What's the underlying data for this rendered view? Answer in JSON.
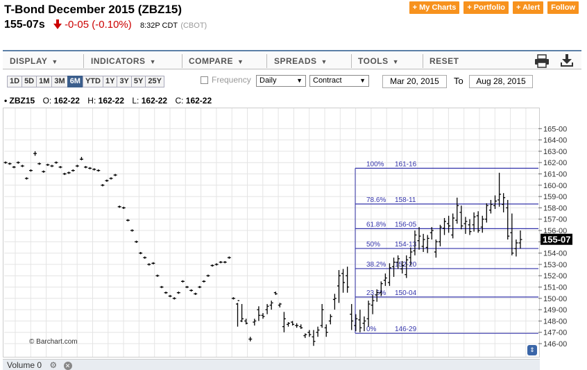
{
  "header": {
    "title": "T-Bond December 2015 (ZBZ15)",
    "last": "155-07s",
    "change": "-0-05 (-0.10%)",
    "time": "8:32P CDT",
    "exchange": "(CBOT)"
  },
  "buttons": [
    "+ My Charts",
    "+ Portfolio",
    "+ Alert",
    "Follow"
  ],
  "toolbar": {
    "display": "DISPLAY",
    "indicators": "INDICATORS",
    "compare": "COMPARE",
    "spreads": "SPREADS",
    "tools": "TOOLS",
    "reset": "RESET"
  },
  "ranges": [
    "1D",
    "5D",
    "1M",
    "3M",
    "6M",
    "YTD",
    "1Y",
    "3Y",
    "5Y",
    "25Y"
  ],
  "active_range": "6M",
  "frequency_label": "Frequency",
  "frequency_value": "Daily",
  "contract_value": "Contract",
  "date_from": "Mar 20, 2015",
  "to_label": "To",
  "date_to": "Aug 28, 2015",
  "ohlc": {
    "symbol": "• ZBZ15",
    "o_label": "O:",
    "o": "162-22",
    "h_label": "H:",
    "h": "162-22",
    "l_label": "L:",
    "l": "162-22",
    "c_label": "C:",
    "c": "162-22"
  },
  "credit": "© Barchart.com",
  "volume_label": "Volume 0",
  "colors": {
    "fib_line": "#3333aa",
    "orange": "#f7921e",
    "active": "#3b5e8c"
  },
  "chart_data": {
    "type": "ohlc",
    "y_ticks": [
      "146-00",
      "147-00",
      "148-00",
      "149-00",
      "150-00",
      "151-00",
      "152-00",
      "153-00",
      "154-00",
      "155-00",
      "156-00",
      "157-00",
      "158-00",
      "159-00",
      "160-00",
      "161-00",
      "162-00",
      "163-00",
      "164-00",
      "165-00"
    ],
    "ylim": [
      145.5,
      165.5
    ],
    "current_price_label": "155-07",
    "current_price": 155.22,
    "fib_levels": [
      {
        "pct": "100%",
        "price_label": "161-16",
        "value": 161.5
      },
      {
        "pct": "78.6%",
        "price_label": "158-11",
        "value": 158.34
      },
      {
        "pct": "61.8%",
        "price_label": "156-05",
        "value": 156.16
      },
      {
        "pct": "50%",
        "price_label": "154-13",
        "value": 154.41
      },
      {
        "pct": "38.2%",
        "price_label": "152-20",
        "value": 152.63
      },
      {
        "pct": "23.6%",
        "price_label": "150-04",
        "value": 150.12
      },
      {
        "pct": "0%",
        "price_label": "146-29",
        "value": 146.91
      }
    ],
    "gridlines": true,
    "bars": [
      [
        162.0,
        162.1,
        161.9,
        162.0
      ],
      [
        161.9,
        162.0,
        161.8,
        161.9
      ],
      [
        161.6,
        161.7,
        161.5,
        161.6
      ],
      [
        162.0,
        162.1,
        161.9,
        162.0
      ],
      [
        161.7,
        161.8,
        161.6,
        161.7
      ],
      [
        160.6,
        160.7,
        160.5,
        160.6
      ],
      [
        161.3,
        161.4,
        161.2,
        161.3
      ],
      [
        162.8,
        163.0,
        162.6,
        162.8
      ],
      [
        161.9,
        162.0,
        161.8,
        161.9
      ],
      [
        161.2,
        161.3,
        161.1,
        161.2
      ],
      [
        161.8,
        161.9,
        161.7,
        161.8
      ],
      [
        161.7,
        161.8,
        161.6,
        161.7
      ],
      [
        162.0,
        162.1,
        161.9,
        162.0
      ],
      [
        161.6,
        161.7,
        161.5,
        161.6
      ],
      [
        161.0,
        161.1,
        160.9,
        161.0
      ],
      [
        161.1,
        161.2,
        161.0,
        161.1
      ],
      [
        161.3,
        161.4,
        161.2,
        161.3
      ],
      [
        161.7,
        161.8,
        161.6,
        161.7
      ],
      [
        162.3,
        162.5,
        162.2,
        162.3
      ],
      [
        161.6,
        161.7,
        161.5,
        161.6
      ],
      [
        161.5,
        161.6,
        161.4,
        161.5
      ],
      [
        161.4,
        161.5,
        161.3,
        161.4
      ],
      [
        161.3,
        161.4,
        161.2,
        161.3
      ],
      [
        160.0,
        160.1,
        159.9,
        160.0
      ],
      [
        160.4,
        160.5,
        160.3,
        160.4
      ],
      [
        160.6,
        160.7,
        160.5,
        160.6
      ],
      [
        160.9,
        161.0,
        160.8,
        160.9
      ],
      [
        158.1,
        158.2,
        158.0,
        158.1
      ],
      [
        158.0,
        158.1,
        157.9,
        158.0
      ],
      [
        156.9,
        157.0,
        156.8,
        156.9
      ],
      [
        156.0,
        156.1,
        155.9,
        156.0
      ],
      [
        155.0,
        155.1,
        154.9,
        155.0
      ],
      [
        154.0,
        154.1,
        153.9,
        154.0
      ],
      [
        153.6,
        153.7,
        153.5,
        153.6
      ],
      [
        153.0,
        153.1,
        152.9,
        153.0
      ],
      [
        153.1,
        153.2,
        153.0,
        153.1
      ],
      [
        152.0,
        152.1,
        151.9,
        152.0
      ],
      [
        151.0,
        151.1,
        150.9,
        151.0
      ],
      [
        150.5,
        150.6,
        150.4,
        150.5
      ],
      [
        150.2,
        150.3,
        150.1,
        150.2
      ],
      [
        150.0,
        150.1,
        149.9,
        150.0
      ],
      [
        150.5,
        150.6,
        150.4,
        150.5
      ],
      [
        151.5,
        151.6,
        151.4,
        151.5
      ],
      [
        151.0,
        151.1,
        150.9,
        151.0
      ],
      [
        150.7,
        150.8,
        150.6,
        150.7
      ],
      [
        150.4,
        150.5,
        150.3,
        150.4
      ],
      [
        151.0,
        151.1,
        150.9,
        151.0
      ],
      [
        151.5,
        151.6,
        151.4,
        151.5
      ],
      [
        152.0,
        152.1,
        151.9,
        152.0
      ],
      [
        152.9,
        153.0,
        152.8,
        152.9
      ],
      [
        153.0,
        153.1,
        152.9,
        153.0
      ],
      [
        153.2,
        153.3,
        153.1,
        153.2
      ],
      [
        153.2,
        153.3,
        153.1,
        153.2
      ],
      [
        153.6,
        153.7,
        153.5,
        153.6
      ],
      [
        150.0,
        150.1,
        149.9,
        150.0
      ],
      [
        149.5,
        149.6,
        147.5,
        149.8
      ],
      [
        148.0,
        149.5,
        147.9,
        148.2
      ],
      [
        148.0,
        148.2,
        147.7,
        147.8
      ],
      [
        146.4,
        146.6,
        146.2,
        146.4
      ],
      [
        147.9,
        148.2,
        147.6,
        148.0
      ],
      [
        149.0,
        149.3,
        148.0,
        148.5
      ],
      [
        148.5,
        148.7,
        148.2,
        148.4
      ],
      [
        149.0,
        149.5,
        148.6,
        149.3
      ],
      [
        149.4,
        149.8,
        149.0,
        149.6
      ],
      [
        150.5,
        150.6,
        150.3,
        150.4
      ],
      [
        149.4,
        149.6,
        149.2,
        149.5
      ],
      [
        147.5,
        148.8,
        147.0,
        148.2
      ],
      [
        147.7,
        147.9,
        147.5,
        147.8
      ],
      [
        147.9,
        148.0,
        147.6,
        147.7
      ],
      [
        147.6,
        147.8,
        147.4,
        147.6
      ],
      [
        147.5,
        147.7,
        147.3,
        147.4
      ],
      [
        146.7,
        146.9,
        146.5,
        146.8
      ],
      [
        147.0,
        147.2,
        146.6,
        146.8
      ],
      [
        146.6,
        147.2,
        145.8,
        146.2
      ],
      [
        147.0,
        147.5,
        146.6,
        147.2
      ],
      [
        147.6,
        149.5,
        147.4,
        149.0
      ],
      [
        147.4,
        147.7,
        146.6,
        147.0
      ],
      [
        148.0,
        148.6,
        147.7,
        148.4
      ],
      [
        149.9,
        150.4,
        149.0,
        150.0
      ],
      [
        151.1,
        152.5,
        149.6,
        152.0
      ],
      [
        152.2,
        152.6,
        150.5,
        151.4
      ],
      [
        152.0,
        152.8,
        150.5,
        151.0
      ],
      [
        148.6,
        149.5,
        147.2,
        148.0
      ],
      [
        147.6,
        148.6,
        147.1,
        148.2
      ],
      [
        148.1,
        149.0,
        147.0,
        147.4
      ],
      [
        147.8,
        148.4,
        147.1,
        148.0
      ],
      [
        148.2,
        149.8,
        147.5,
        149.5
      ],
      [
        149.4,
        150.3,
        148.6,
        149.8
      ],
      [
        150.3,
        150.8,
        149.7,
        150.5
      ],
      [
        150.5,
        151.5,
        150.2,
        151.3
      ],
      [
        151.6,
        152.2,
        151.1,
        151.8
      ],
      [
        151.4,
        153.1,
        151.1,
        152.7
      ],
      [
        152.8,
        153.6,
        151.9,
        153.2
      ],
      [
        153.2,
        153.8,
        152.6,
        153.5
      ],
      [
        152.6,
        153.3,
        152.2,
        152.9
      ],
      [
        152.1,
        153.8,
        151.8,
        153.4
      ],
      [
        153.6,
        154.5,
        152.9,
        154.1
      ],
      [
        154.2,
        156.0,
        153.8,
        155.6
      ],
      [
        155.1,
        156.3,
        154.3,
        155.5
      ],
      [
        154.6,
        155.7,
        154.1,
        155.2
      ],
      [
        154.5,
        155.6,
        154.0,
        155.3
      ],
      [
        155.8,
        156.3,
        155.2,
        156.0
      ],
      [
        154.1,
        155.2,
        153.6,
        155.0
      ],
      [
        155.0,
        156.5,
        154.6,
        156.3
      ],
      [
        156.2,
        157.1,
        155.6,
        156.8
      ],
      [
        156.6,
        157.3,
        155.8,
        156.4
      ],
      [
        155.6,
        157.5,
        155.3,
        157.1
      ],
      [
        156.9,
        158.9,
        156.6,
        158.2
      ],
      [
        157.6,
        158.2,
        156.1,
        156.4
      ],
      [
        156.6,
        157.2,
        155.7,
        156.8
      ],
      [
        156.5,
        157.0,
        155.6,
        155.9
      ],
      [
        156.5,
        157.6,
        155.9,
        157.2
      ],
      [
        157.3,
        157.7,
        155.8,
        156.0
      ],
      [
        156.3,
        157.3,
        155.8,
        157.0
      ],
      [
        157.0,
        158.4,
        156.7,
        158.2
      ],
      [
        157.8,
        158.7,
        157.5,
        158.3
      ],
      [
        158.2,
        159.1,
        157.9,
        158.6
      ],
      [
        158.7,
        161.1,
        158.1,
        159.2
      ],
      [
        158.3,
        159.3,
        157.6,
        158.9
      ],
      [
        158.0,
        158.7,
        155.2,
        155.5
      ],
      [
        155.8,
        157.5,
        153.8,
        154.0
      ],
      [
        154.4,
        155.2,
        153.7,
        154.9
      ],
      [
        154.9,
        156.0,
        154.4,
        155.2
      ]
    ]
  }
}
